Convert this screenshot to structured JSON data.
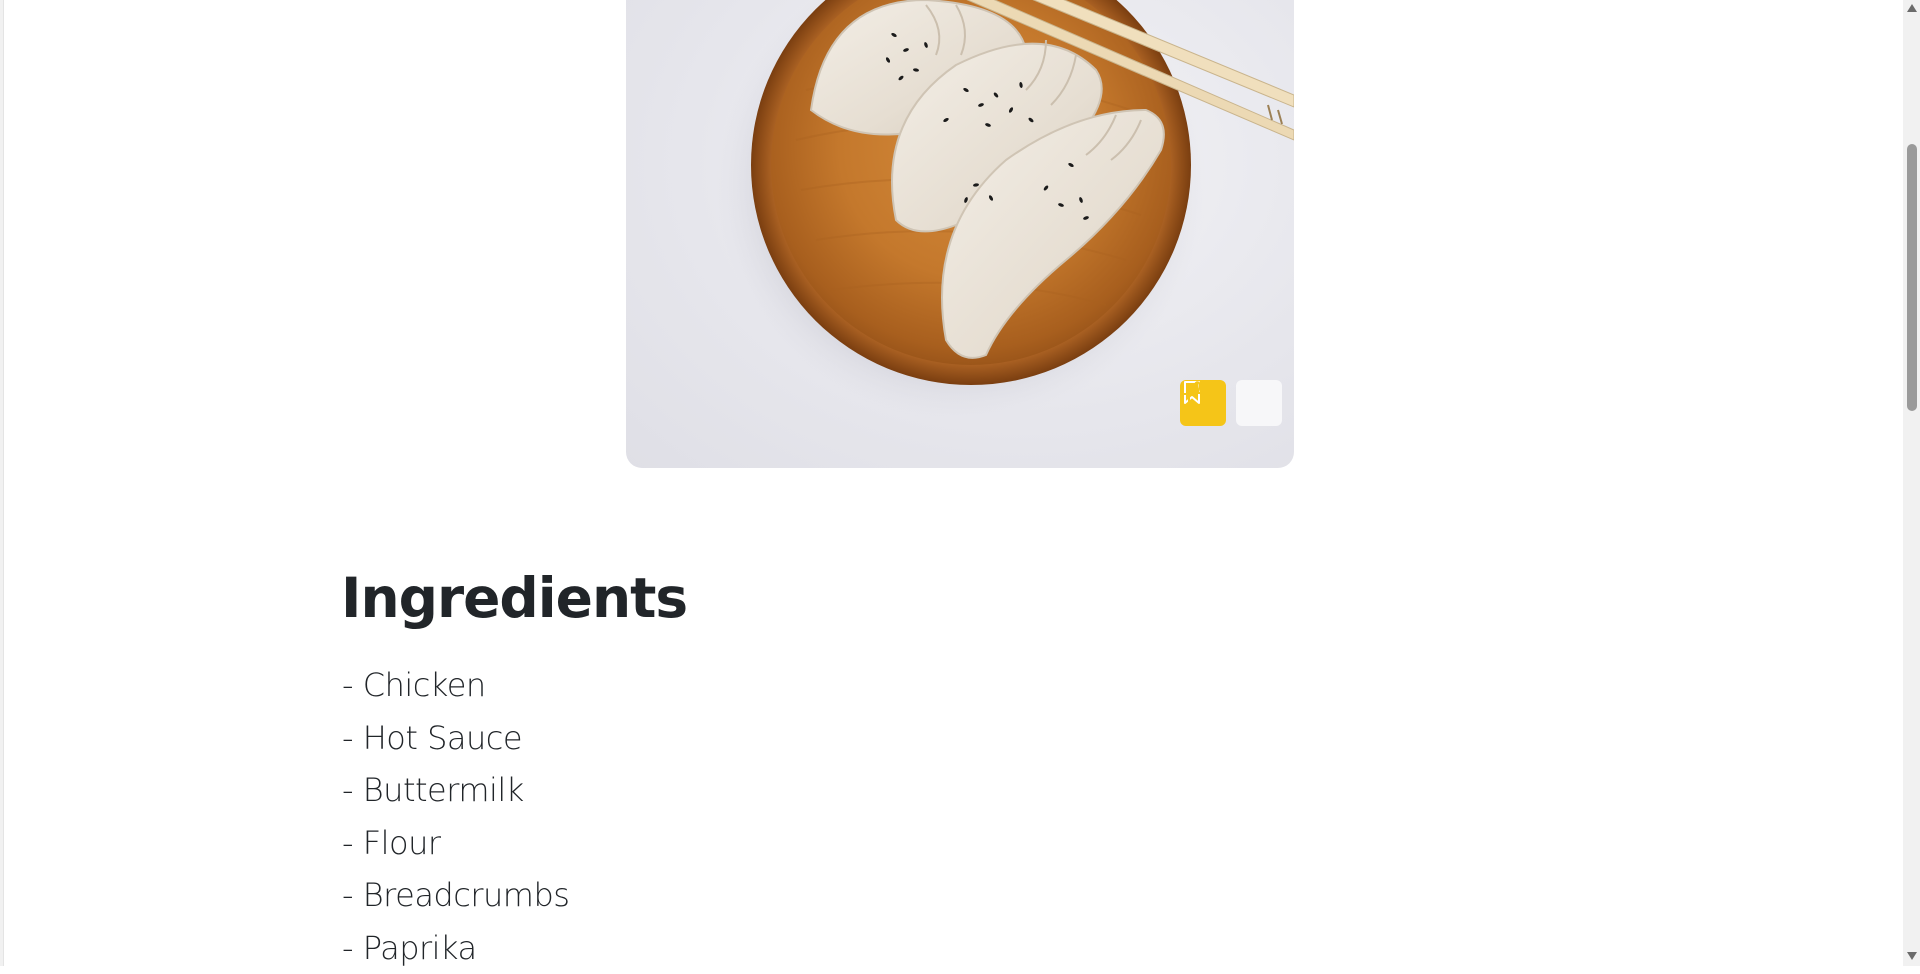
{
  "hero": {
    "image_alt": "Dumplings on a wooden plate with chopsticks",
    "icons": {
      "bookmark": "bookmark-icon",
      "like": "thumbs-up-icon"
    },
    "colors": {
      "accent": "#f5c518",
      "like_background": "#f7f7f9"
    }
  },
  "ingredients": {
    "title": "Ingredients",
    "items": [
      "- Chicken",
      "- Hot Sauce",
      "- Buttermilk",
      "- Flour",
      "- Breadcrumbs",
      "- Paprika"
    ]
  }
}
